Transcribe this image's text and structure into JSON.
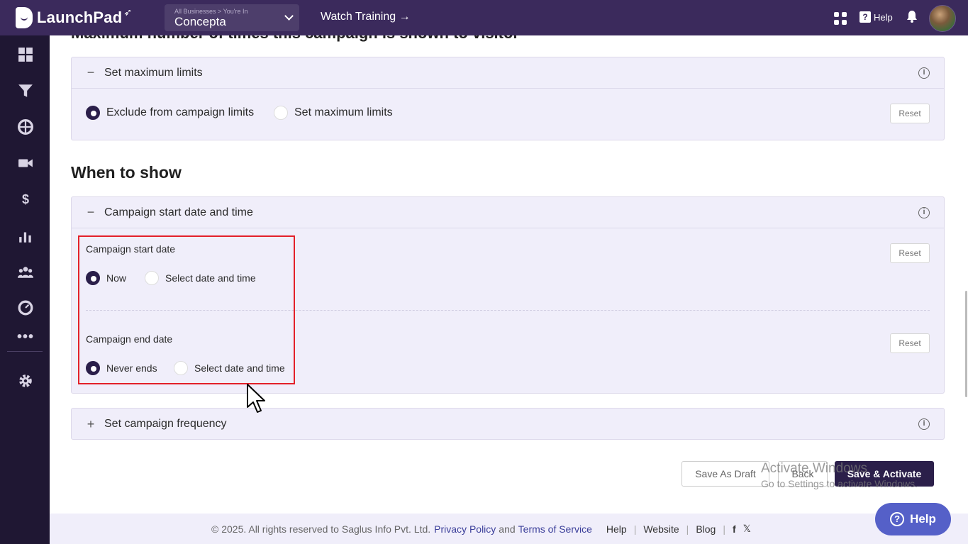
{
  "header": {
    "app_name": "LaunchPad",
    "business_hint": "All Businesses > You're In",
    "business_name": "Concepta",
    "watch_training": "Watch Training →",
    "help": "Help"
  },
  "sidebar": {
    "icons": [
      "dashboard-icon",
      "funnel-icon",
      "globe-icon",
      "video-icon",
      "dollar-icon",
      "chart-icon",
      "users-icon",
      "gauge-icon",
      "more-icon",
      "settings-icon"
    ]
  },
  "main": {
    "clipped_heading": "Maximum number of times this campaign is shown to visitor",
    "limits_panel": {
      "title": "Set maximum limits",
      "option_exclude": "Exclude from campaign limits",
      "option_set": "Set maximum limits",
      "reset": "Reset"
    },
    "when_to_show": "When to show",
    "start_panel": {
      "title": "Campaign start date and time",
      "start_label": "Campaign start date",
      "start_now": "Now",
      "start_select": "Select date and time",
      "end_label": "Campaign end date",
      "end_never": "Never ends",
      "end_select": "Select date and time",
      "reset": "Reset"
    },
    "frequency_panel": {
      "title": "Set campaign frequency"
    },
    "buttons": {
      "save_draft": "Save As Draft",
      "back": "Back",
      "save_activate": "Save & Activate"
    },
    "watermark": {
      "line1": "Activate Windows",
      "line2": "Go to Settings to activate Windows."
    }
  },
  "footer": {
    "copyright": "©  2025. All rights reserved to Saglus Info Pvt. Ltd.",
    "privacy": "Privacy Policy",
    "and": "and",
    "terms": "Terms of Service",
    "help": "Help",
    "website": "Website",
    "blog": "Blog"
  },
  "help_button": "Help",
  "colors": {
    "topbar": "#3b2a5c",
    "sidebar": "#1f1733",
    "panel": "#f0eefa",
    "primary": "#2b1f4a",
    "highlight": "#e3202a",
    "help_button": "#5560c8"
  }
}
